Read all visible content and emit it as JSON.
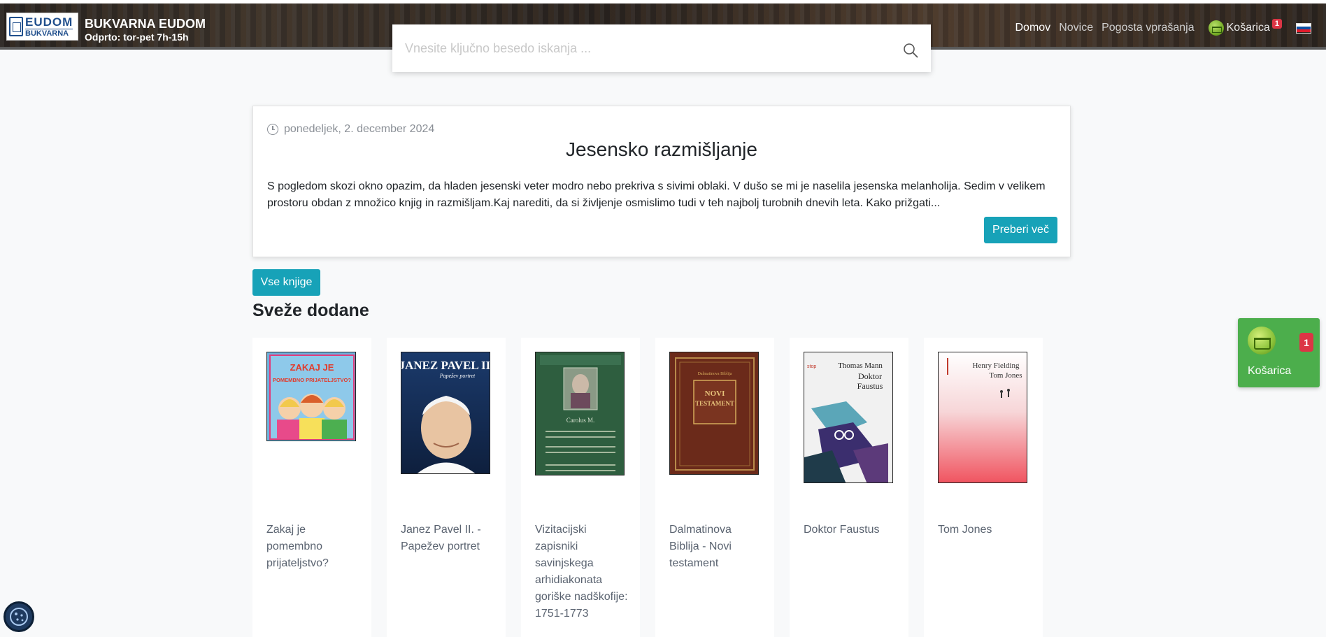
{
  "header": {
    "logo_line1": "EUDOM",
    "logo_line2": "BUKVARNA",
    "brand_name": "BUKVARNA EUDOM",
    "hours": "Odprto: tor-pet 7h-15h",
    "nav": {
      "home": "Domov",
      "news": "Novice",
      "faq": "Pogosta vprašanja",
      "cart": "Košarica",
      "cart_count": "1"
    }
  },
  "search": {
    "placeholder": "Vnesite ključno besedo iskanja ..."
  },
  "news": {
    "date": "ponedeljek, 2. december 2024",
    "title": "Jesensko razmišljanje",
    "body": "S pogledom skozi okno opazim, da hladen jesenski veter modro nebo prekriva s sivimi oblaki. V dušo se mi je naselila jesenska melanholija. Sedim v velikem prostoru obdan z množico knjig in razmišljam.Kaj narediti, da si življenje osmislimo tudi v teh najbolj turobnih dnevih leta. Kako prižgati...",
    "read_more": "Preberi več"
  },
  "all_books_button": "Vse knjige",
  "section_title": "Sveže dodane",
  "books": [
    {
      "title": "Zakaj je pomembno prijateljstvo?",
      "cover_text": "ZAKAJ JE POMEMBNO PRIJATELJSTVO?"
    },
    {
      "title": "Janez Pavel II. - Papežev portret",
      "cover_text": "JANEZ PAVEL II."
    },
    {
      "title": "Vizitacijski zapisniki savinjskega arhidiakonata goriške nadškofije: 1751-1773",
      "cover_text": ""
    },
    {
      "title": "Dalmatinova Biblija - Novi testament",
      "cover_text": "NOVI TESTAMENT"
    },
    {
      "title": "Doktor Faustus",
      "cover_text": "Thomas Mann Doktor Faustus"
    },
    {
      "title": "Tom Jones",
      "cover_text": "Henry Fielding Tom Jones"
    }
  ],
  "floating_cart": {
    "label": "Košarica",
    "count": "1"
  },
  "colors": {
    "accent": "#17a2b8",
    "cart_green": "#4cae4c",
    "badge_red": "#dc3545"
  }
}
